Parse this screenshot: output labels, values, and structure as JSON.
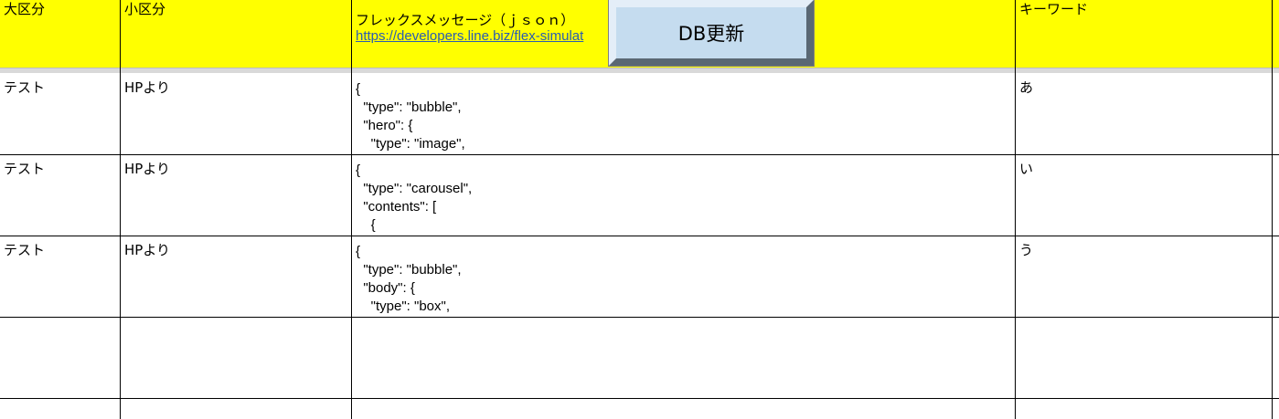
{
  "header": {
    "col1": "大区分",
    "col2": "小区分",
    "col3": "フレックスメッセージ（ｊｓｏｎ）",
    "col3_link": "https://developers.line.biz/flex-simulat",
    "col4": "キーワード"
  },
  "button": {
    "label": "DB更新"
  },
  "rows": [
    {
      "col1": "テスト",
      "col2": "HPより",
      "json": "{\n  \"type\": \"bubble\",\n  \"hero\": {\n    \"type\": \"image\",\n    \"url\": \"https://scdn.line-apps.com/n/channel_devcenter/img/fx/01_1_cafe.png\",",
      "keyword": "あ"
    },
    {
      "col1": "テスト",
      "col2": "HPより",
      "json": "{\n  \"type\": \"carousel\",\n  \"contents\": [\n    {\n      \"type\": \"bubble\",",
      "keyword": "い"
    },
    {
      "col1": "テスト",
      "col2": "HPより",
      "json": "{\n  \"type\": \"bubble\",\n  \"body\": {\n    \"type\": \"box\",\n    \"layout\": \"vertical\",",
      "keyword": "う"
    },
    {
      "col1": "",
      "col2": "",
      "json": "",
      "keyword": ""
    }
  ]
}
